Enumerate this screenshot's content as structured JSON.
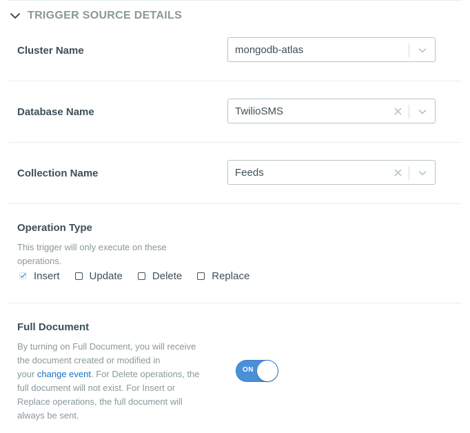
{
  "section": {
    "title": "TRIGGER SOURCE DETAILS"
  },
  "cluster": {
    "label": "Cluster Name",
    "value": "mongodb-atlas"
  },
  "database": {
    "label": "Database Name",
    "value": "TwilioSMS"
  },
  "collection": {
    "label": "Collection Name",
    "value": "Feeds"
  },
  "operation": {
    "title": "Operation Type",
    "description_line1": "This trigger will only execute on these",
    "description_line2": "operations.",
    "options": [
      {
        "label": "Insert",
        "checked": true
      },
      {
        "label": "Update",
        "checked": false
      },
      {
        "label": "Delete",
        "checked": false
      },
      {
        "label": "Replace",
        "checked": false
      }
    ]
  },
  "full_document": {
    "title": "Full Document",
    "line1": "By turning on Full Document, you will receive",
    "line2": "the document created or modified in",
    "line3_prefix": "your ",
    "link_text": "change event",
    "line3_suffix": ". For Delete operations, the",
    "line4": "full document will not exist. For Insert or",
    "line5": "Replace operations, the full document will",
    "line6": "always be sent.",
    "toggle_label": "ON",
    "toggle_on": true
  },
  "colors": {
    "accent": "#4a90d9",
    "link": "#1a6ec2",
    "muted": "#89979b",
    "text": "#3d4f58"
  }
}
